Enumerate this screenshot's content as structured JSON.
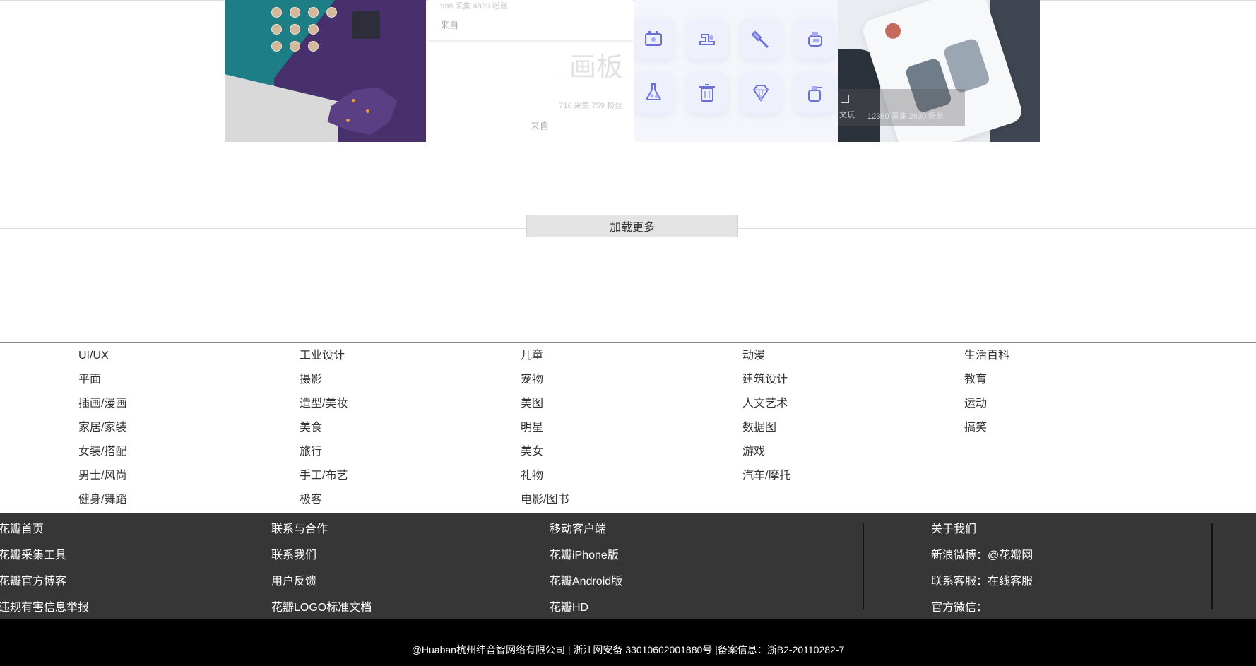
{
  "cards": {
    "card2": {
      "meta_top": "998 采集   4839 粉丝",
      "from_label_1": "来自",
      "board_word": "画板",
      "meta_bottom": "716 采集   759 粉丝",
      "from_label_2": "来自"
    },
    "card4": {
      "overlay_label": "文玩",
      "overlay_stats": "12360 采集   2630 粉丝"
    }
  },
  "load_more": {
    "label": "加载更多"
  },
  "categories": {
    "col1": [
      "UI/UX",
      "平面",
      "插画/漫画",
      "家居/家装",
      "女装/搭配",
      "男士/风尚",
      "健身/舞蹈"
    ],
    "col2": [
      "工业设计",
      "摄影",
      "造型/美妆",
      "美食",
      "旅行",
      "手工/布艺",
      "极客"
    ],
    "col3": [
      "儿童",
      "宠物",
      "美图",
      "明星",
      "美女",
      "礼物",
      "电影/图书"
    ],
    "col4": [
      "动漫",
      "建筑设计",
      "人文艺术",
      "数据图",
      "游戏",
      "汽车/摩托"
    ],
    "col5": [
      "生活百科",
      "教育",
      "运动",
      "搞笑"
    ]
  },
  "footer": {
    "col1": [
      "花瓣首页",
      "花瓣采集工具",
      "花瓣官方博客",
      "违规有害信息举报"
    ],
    "col2": [
      "联系与合作",
      "联系我们",
      "用户反馈",
      "花瓣LOGO标准文档"
    ],
    "col3": [
      "移动客户端",
      "花瓣iPhone版",
      "花瓣Android版",
      "花瓣HD"
    ],
    "col4": [
      "关于我们",
      "新浪微博：@花瓣网",
      "联系客服：在线客服",
      "官方微信："
    ]
  },
  "copyright": "@Huaban杭州纬音智网络有限公司 | 浙江网安备 33010602001880号 |备案信息：浙B2-20110282-7",
  "colors": {
    "footer_bg": "#363636",
    "bottom_bg": "#000000",
    "teal": "#1d7e86",
    "purple": "#47306b",
    "icon_accent": "#6b6fd8"
  }
}
